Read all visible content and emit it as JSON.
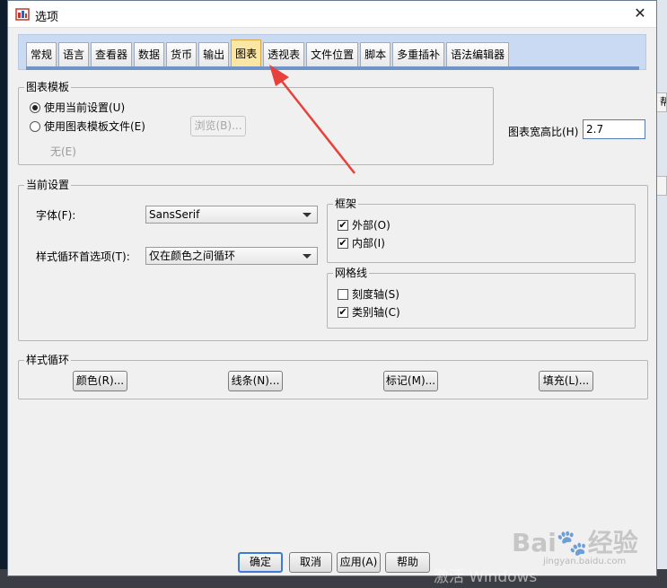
{
  "window": {
    "title": "选项",
    "close_glyph": "✕"
  },
  "tabs": [
    "常规",
    "语言",
    "查看器",
    "数据",
    "货币",
    "输出",
    "图表",
    "透视表",
    "文件位置",
    "脚本",
    "多重插补",
    "语法编辑器"
  ],
  "active_tab": "图表",
  "chart_template": {
    "group_label": "图表模板",
    "option_current": "使用当前设置(U)",
    "option_file": "使用图表模板文件(E)",
    "browse_button": "浏览(B)...",
    "no_file": "无(E)"
  },
  "aspect_ratio": {
    "label": "图表宽高比(H)",
    "value": "2.7"
  },
  "current_settings": {
    "group_label": "当前设置",
    "font_label": "字体(F):",
    "font_value": "SansSerif",
    "cycle_label": "样式循环首选项(T):",
    "cycle_value": "仅在颜色之间循环",
    "frame": {
      "group_label": "框架",
      "outer": "外部(O)",
      "outer_checked": true,
      "inner": "内部(I)",
      "inner_checked": true
    },
    "gridlines": {
      "group_label": "网格线",
      "scale_axis": "刻度轴(S)",
      "scale_checked": false,
      "category_axis": "类别轴(C)",
      "category_checked": true
    }
  },
  "style_cycles": {
    "group_label": "样式循环",
    "colors": "颜色(R)...",
    "lines": "线条(N)...",
    "markers": "标记(M)...",
    "fills": "填充(L)..."
  },
  "footer": {
    "ok": "确定",
    "cancel": "取消",
    "apply": "应用(A)",
    "help": "帮助"
  },
  "background": {
    "right_tab_1": "帮",
    "activate_windows": "激活 Windows",
    "baidu_text": "Bai",
    "baidu_text_2": "经验",
    "baidu_url": "jingyan.baidu.com"
  },
  "colors": {
    "accent_blue": "#3d7bd5",
    "active_tab": "#fce6a3",
    "arrow_red": "#e8413b",
    "tab_area": "#c9daf2"
  }
}
